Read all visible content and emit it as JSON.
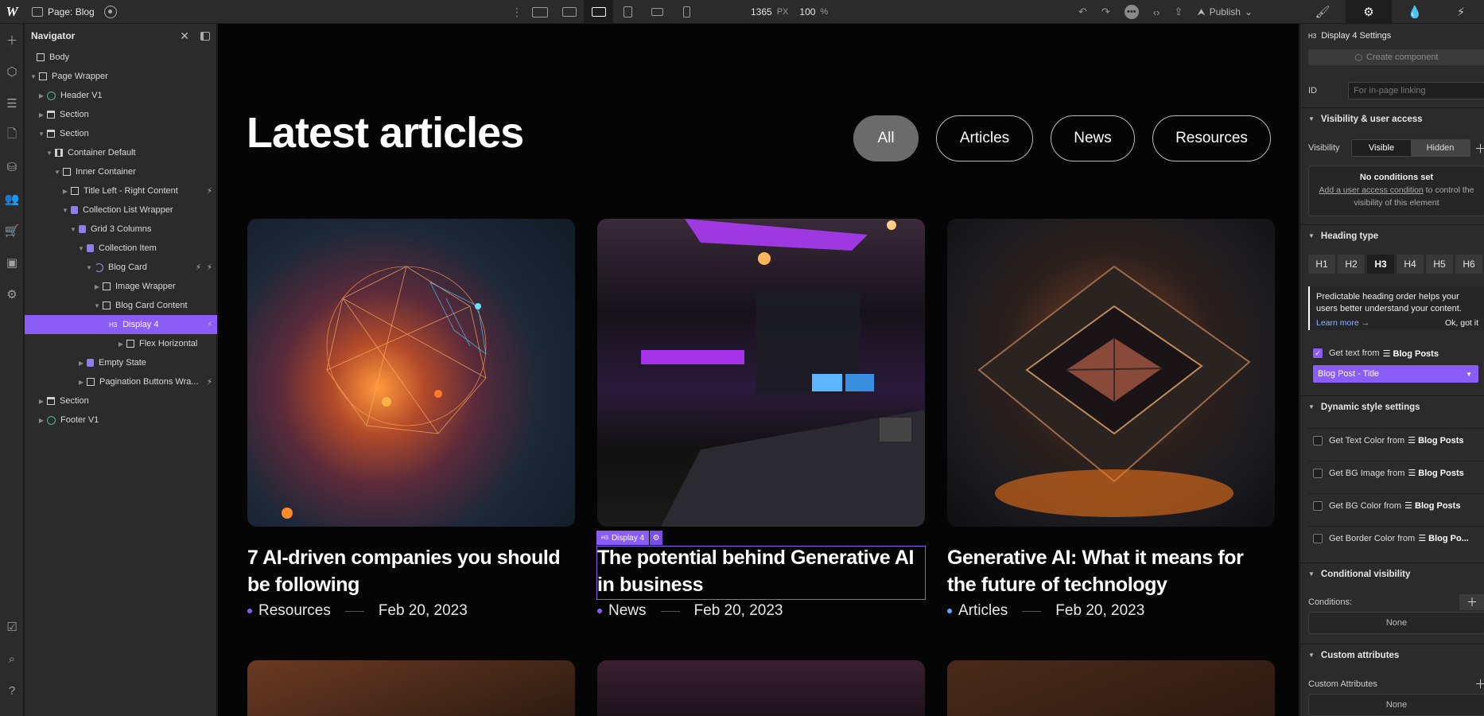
{
  "topbar": {
    "logo": "W",
    "page_label": "Page: Blog",
    "width_value": "1365",
    "width_unit": "PX",
    "zoom": "100",
    "zoom_unit": "%",
    "publish_label": "Publish"
  },
  "navigator": {
    "title": "Navigator",
    "items": [
      {
        "label": "Body"
      },
      {
        "label": "Page Wrapper"
      },
      {
        "label": "Header V1"
      },
      {
        "label": "Section"
      },
      {
        "label": "Section"
      },
      {
        "label": "Container Default"
      },
      {
        "label": "Inner Container"
      },
      {
        "label": "Title Left - Right Content"
      },
      {
        "label": "Collection List Wrapper"
      },
      {
        "label": "Grid 3 Columns"
      },
      {
        "label": "Collection Item"
      },
      {
        "label": "Blog Card"
      },
      {
        "label": "Image Wrapper"
      },
      {
        "label": "Blog Card Content"
      },
      {
        "label": "Display 4",
        "tag": "H3"
      },
      {
        "label": "Flex Horizontal"
      },
      {
        "label": "Empty State"
      },
      {
        "label": "Pagination Buttons Wra..."
      },
      {
        "label": "Section"
      },
      {
        "label": "Footer V1"
      }
    ]
  },
  "canvas": {
    "headline": "Latest articles",
    "filters": [
      "All",
      "Articles",
      "News",
      "Resources"
    ],
    "selection_tag": {
      "tag": "H3",
      "label": "Display 4"
    },
    "cards": [
      {
        "title": "7 AI-driven companies you should be following",
        "category": "Resources",
        "date": "Feb 20, 2023",
        "dot_color": "#8b5cf6"
      },
      {
        "title": "The potential behind Generative AI in business",
        "category": "News",
        "date": "Feb 20, 2023",
        "dot_color": "#8b5cf6"
      },
      {
        "title": "Generative AI: What it means for the future of technology",
        "category": "Articles",
        "date": "Feb 20, 2023",
        "dot_color": "#5aa9ff"
      }
    ]
  },
  "panel": {
    "element_tag": "H3",
    "element_title": "Display 4 Settings",
    "create_component": "Create component",
    "id_label": "ID",
    "id_placeholder": "For in-page linking",
    "sections": {
      "visibility": "Visibility & user access",
      "heading_type": "Heading type",
      "dynamic": "Dynamic style settings",
      "conditional": "Conditional visibility",
      "custom_attrs": "Custom attributes"
    },
    "visibility_label": "Visibility",
    "visible": "Visible",
    "hidden": "Hidden",
    "no_conditions": "No conditions set",
    "add_condition_link": "Add a user access condition",
    "add_condition_rest": "to control the visibility of this element",
    "headings": [
      "H1",
      "H2",
      "H3",
      "H4",
      "H5",
      "H6"
    ],
    "tip_text": "Predictable heading order helps your users better understand your content.",
    "learn_more": "Learn more →",
    "ok_got_it": "Ok, got it",
    "get_text_from": "Get text from",
    "blog_posts": "Blog Posts",
    "blog_post_title": "Blog Post - Title",
    "dynamic_rows": [
      {
        "label": "Get Text Color from",
        "source": "Blog Posts"
      },
      {
        "label": "Get BG Image from",
        "source": "Blog Posts"
      },
      {
        "label": "Get BG Color from",
        "source": "Blog Posts"
      },
      {
        "label": "Get Border Color from",
        "source": "Blog Po..."
      }
    ],
    "conditions_label": "Conditions:",
    "none": "None",
    "custom_attributes_label": "Custom Attributes"
  }
}
